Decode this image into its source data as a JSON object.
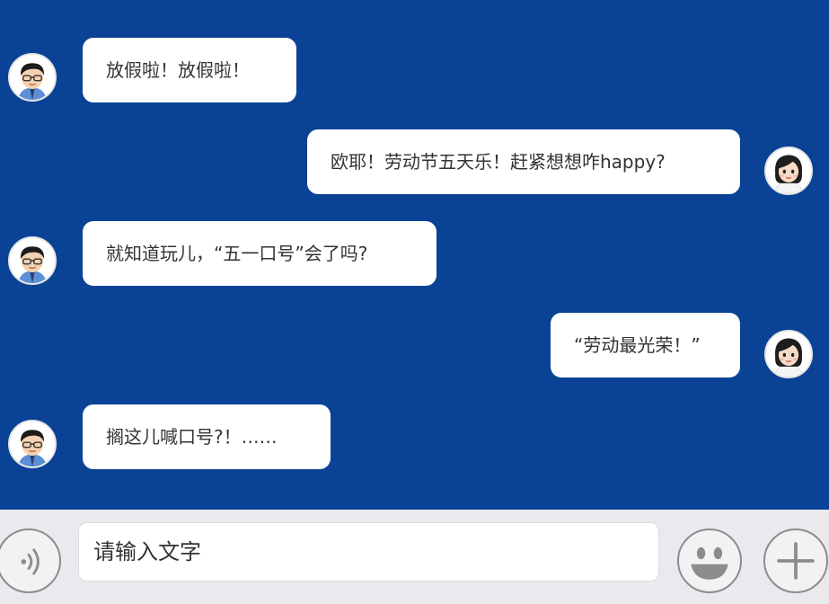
{
  "messages": [
    {
      "sender": "boy",
      "text": "放假啦！放假啦！"
    },
    {
      "sender": "girl",
      "text": "欧耶！劳动节五天乐！赶紧想想咋happy?"
    },
    {
      "sender": "boy",
      "text": "就知道玩儿，“五一口号”会了吗?"
    },
    {
      "sender": "girl",
      "text": "“劳动最光荣！”"
    },
    {
      "sender": "boy",
      "text": "搁这儿喊口号?！……"
    }
  ],
  "input": {
    "placeholder": "请输入文字"
  },
  "colors": {
    "chat_background": "#0a4296",
    "input_bar": "#ebe9ee",
    "bubble": "#ffffff"
  },
  "icons": {
    "voice": "voice-icon",
    "emoji": "smiley-icon",
    "more": "plus-icon"
  }
}
